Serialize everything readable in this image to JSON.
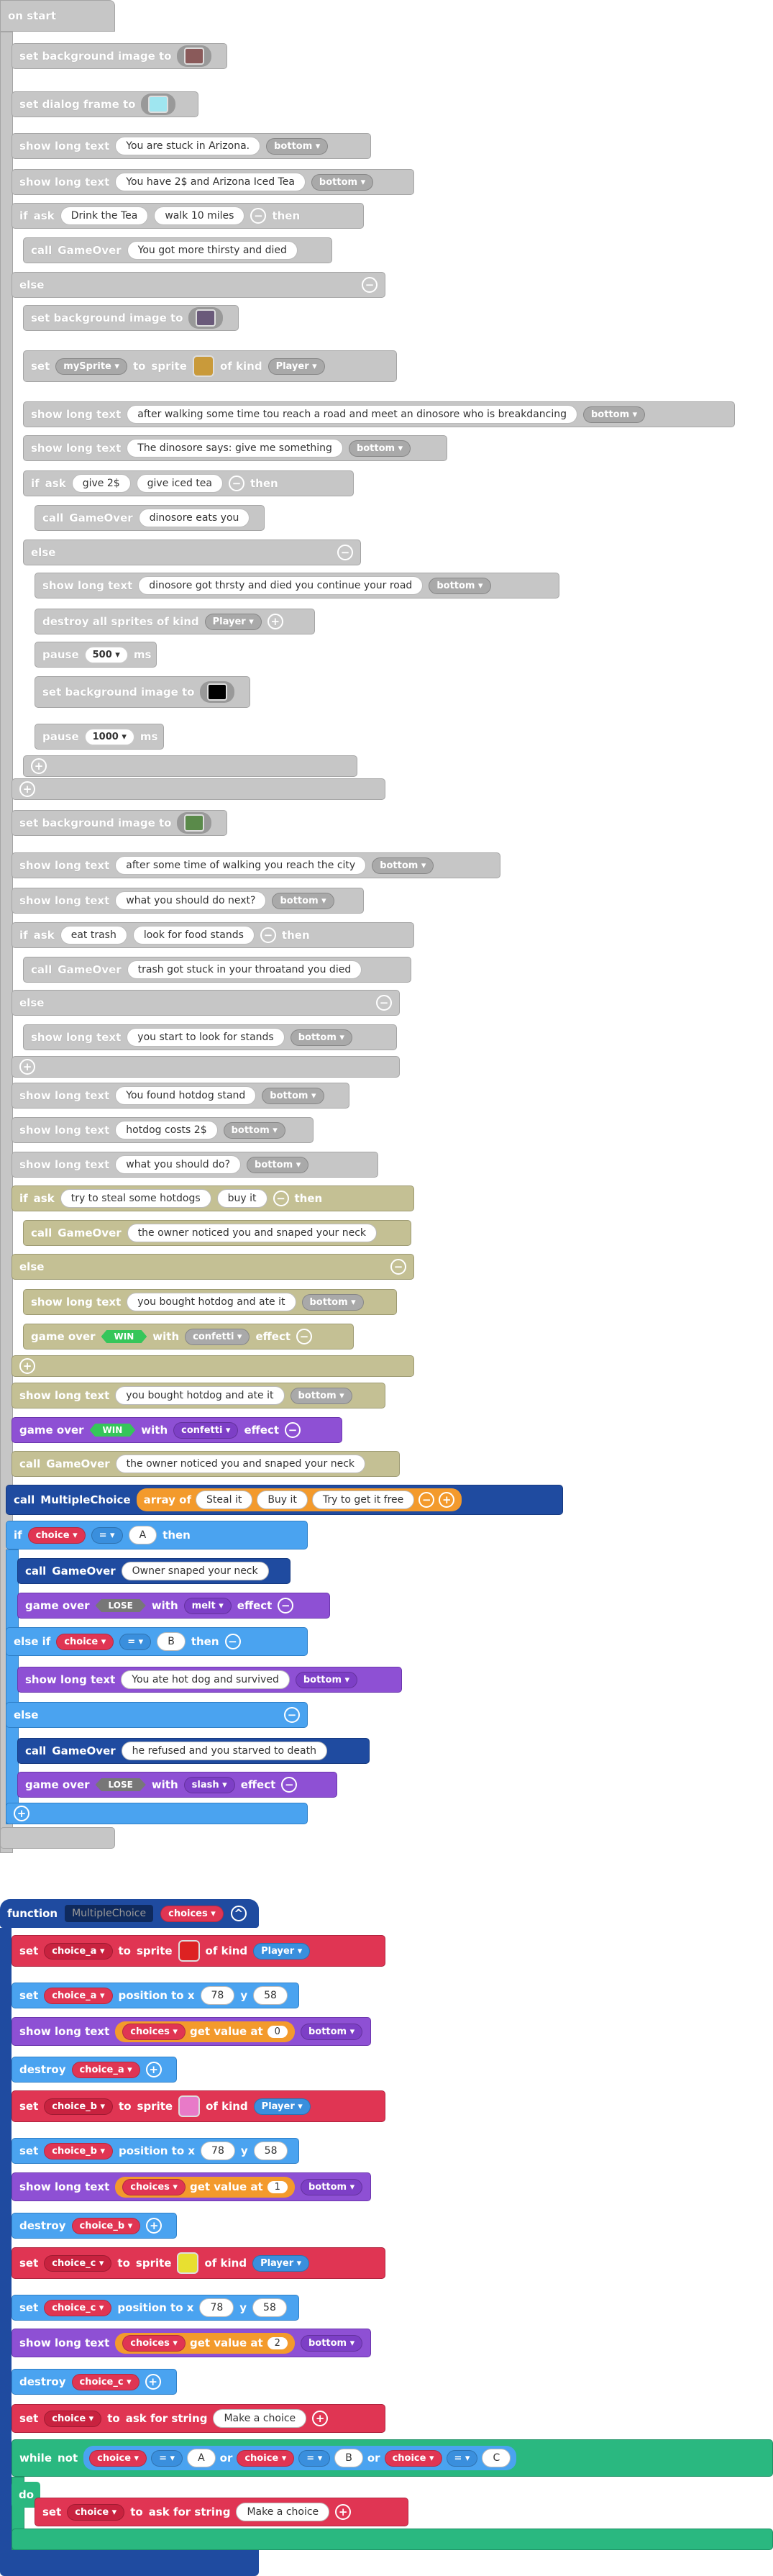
{
  "onstart": {
    "label": "on start"
  },
  "kw": {
    "set_bg": "set background image to",
    "set_dialog": "set dialog frame to",
    "show_long": "show long text",
    "if": "if",
    "else": "else",
    "else_if": "else if",
    "then": "then",
    "ask": "ask",
    "call": "call",
    "set": "set",
    "to": "to",
    "sprite": "sprite",
    "of_kind": "of kind",
    "destroy_all": "destroy all sprites of kind",
    "pause": "pause",
    "ms": "ms",
    "game_over": "game over",
    "with": "with",
    "effect": "effect",
    "array_of": "array of",
    "function": "function",
    "position_to_x": "position to x",
    "y": "y",
    "get_value_at": "get value at",
    "destroy": "destroy",
    "ask_for_string": "ask for string",
    "while": "while",
    "not": "not",
    "or": "or",
    "do": "do"
  },
  "names": {
    "gameover": "GameOver",
    "multiplechoice": "MultipleChoice",
    "mySprite": "mySprite",
    "choice": "choice",
    "choices": "choices",
    "choice_a": "choice_a",
    "choice_b": "choice_b",
    "choice_c": "choice_c",
    "player": "Player",
    "bottom": "bottom",
    "confetti": "confetti",
    "melt": "melt",
    "slash": "slash",
    "win": "WIN",
    "lose": "LOSE"
  },
  "text": {
    "t1": "You are stuck in Arizona.",
    "t2": "You have 2$ and Arizona Iced Tea",
    "a1": "Drink the Tea",
    "a2": "walk 10 miles",
    "g1": "You got more thirsty and died",
    "t3": "after walking some time tou reach a road and meet an dinosore who is breakdancing",
    "t4": "The dinosore says: give me something",
    "a3": "give 2$",
    "a4": "give iced tea",
    "g2": "dinosore eats you",
    "t5": "dinosore got thrsty and died you continue your road",
    "p1": "500",
    "p2": "1000",
    "t6": "after some time of walking you reach the city",
    "t7": "what you should do next?",
    "a5": "eat trash",
    "a6": "look for food stands",
    "g3": "trash got stuck in your throatand you died",
    "t8": "you start to look for stands",
    "t9": "You found hotdog stand",
    "t10": "hotdog costs 2$",
    "t11": "what you should do?",
    "a7": "try to steal some hotdogs",
    "a8": "buy it",
    "g4": "the owner noticed you and snaped your neck",
    "t12": "you bought hotdog and ate it",
    "t13": "you bought hotdog and ate it",
    "g5": "the owner noticed you and snaped your neck",
    "m1": "Steal it",
    "m2": "Buy it",
    "m3": "Try to get it free",
    "ca": "A",
    "cb": "B",
    "cc": "C",
    "eq": "=",
    "g6": "Owner snaped your neck",
    "t14": "You ate hot dog and survived",
    "g7": "he refused and you starved to death",
    "fname": "MultipleChoice",
    "x": "78",
    "yv": "58",
    "i0": "0",
    "i1": "1",
    "i2": "2",
    "prompt": "Make a choice"
  },
  "colors": {
    "disabled": "#c6c6c6",
    "olive": "#c4c094",
    "purple": "#8e50d4",
    "blue": "#4aa3f0",
    "navy": "#1f4ba0",
    "red": "#e03553",
    "teal": "#2ab880",
    "orange": "#f39a2c"
  }
}
